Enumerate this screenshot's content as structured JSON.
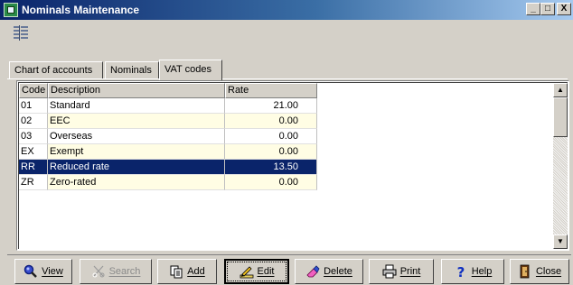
{
  "window": {
    "title": "Nominals Maintenance",
    "minimize": "_",
    "maximize": "□",
    "close": "X"
  },
  "tabs": [
    {
      "label": "Chart of accounts"
    },
    {
      "label": "Nominals"
    },
    {
      "label": "VAT codes"
    }
  ],
  "active_tab": "VAT codes",
  "table": {
    "columns": [
      "Code",
      "Description",
      "Rate"
    ],
    "rows": [
      {
        "code": "01",
        "description": "Standard",
        "rate": "21.00"
      },
      {
        "code": "02",
        "description": "EEC",
        "rate": "0.00"
      },
      {
        "code": "03",
        "description": "Overseas",
        "rate": "0.00"
      },
      {
        "code": "EX",
        "description": "Exempt",
        "rate": "0.00"
      },
      {
        "code": "RR",
        "description": "Reduced rate",
        "rate": "13.50"
      },
      {
        "code": "ZR",
        "description": "Zero-rated",
        "rate": "0.00"
      }
    ],
    "selected_code": "RR"
  },
  "buttons": {
    "view": "View",
    "search": "Search",
    "add": "Add",
    "edit": "Edit",
    "delete": "Delete",
    "print": "Print",
    "help": "Help",
    "close": "Close"
  },
  "icons": {
    "app": "app-icon",
    "toolbar": "grid-tool-icon",
    "view": "magnifier-icon",
    "search": "binoculars-icon",
    "add": "copy-documents-icon",
    "edit": "pencil-edit-icon",
    "delete": "eraser-icon",
    "print": "printer-icon",
    "help": "question-mark-icon",
    "close": "door-exit-icon"
  },
  "colors": {
    "title_gradient_start": "#0a246a",
    "title_gradient_end": "#a6caf0",
    "selection": "#0a246a",
    "row_stripe": "#fffde4",
    "face": "#d4d0c8"
  }
}
